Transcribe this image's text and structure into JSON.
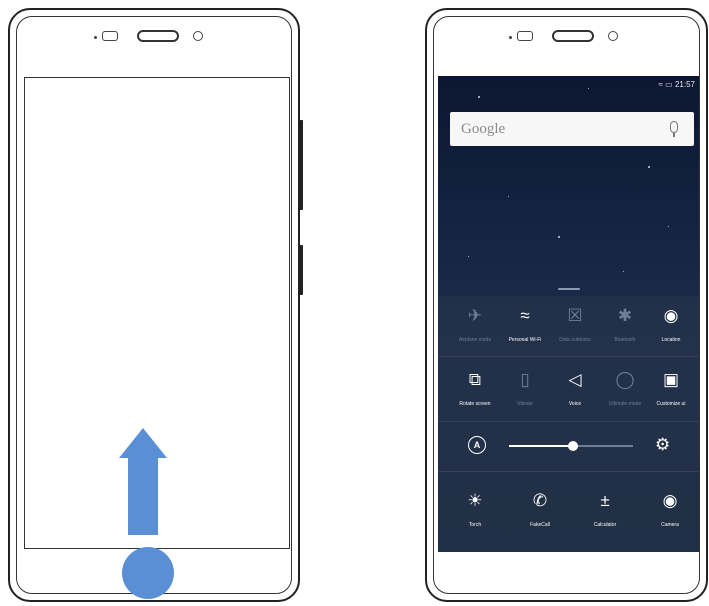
{
  "right_phone": {
    "status_bar": {
      "time": "21:57"
    },
    "search": {
      "placeholder": "Google"
    },
    "quick_settings": {
      "row1": [
        {
          "label": "Airplane mode",
          "icon": "airplane-icon",
          "active": false
        },
        {
          "label": "Personal Wi-Fi",
          "icon": "wifi-icon",
          "active": true
        },
        {
          "label": "Data outdoors",
          "icon": "sim-icon",
          "active": false
        },
        {
          "label": "Bluetooth",
          "icon": "bluetooth-icon",
          "active": false
        },
        {
          "label": "Location",
          "icon": "location-icon",
          "active": true
        }
      ],
      "row2": [
        {
          "label": "Rotate screen",
          "icon": "rotate-icon",
          "active": true
        },
        {
          "label": "Vibrate",
          "icon": "vibrate-icon",
          "active": false
        },
        {
          "label": "Voice",
          "icon": "volume-icon",
          "active": true
        },
        {
          "label": "Ultimate mode",
          "icon": "power-saver-icon",
          "active": false
        },
        {
          "label": "Customize ui",
          "icon": "customize-icon",
          "active": true
        }
      ],
      "brightness_fraction": 0.52,
      "row3": [
        {
          "label": "Torch",
          "icon": "torch-icon"
        },
        {
          "label": "FakeCall",
          "icon": "fakecall-icon"
        },
        {
          "label": "Calculator",
          "icon": "calculator-icon"
        },
        {
          "label": "Camera",
          "icon": "camera-icon"
        }
      ]
    }
  },
  "colors": {
    "accent": "#5a8fd6"
  }
}
